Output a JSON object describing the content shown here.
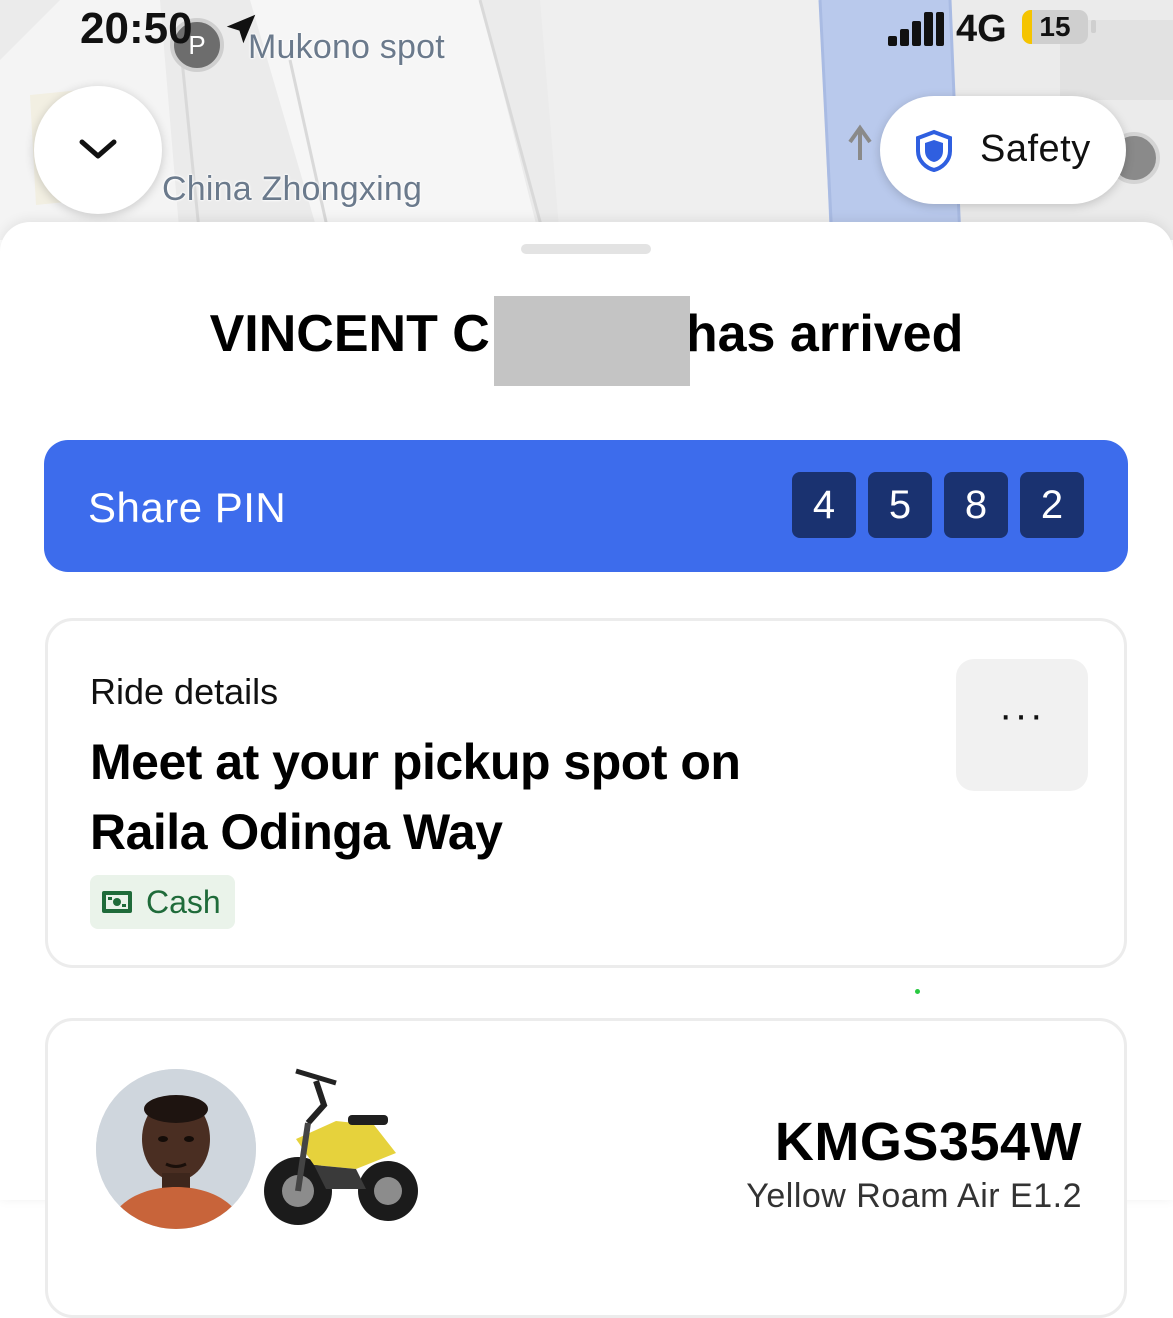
{
  "status_bar": {
    "time": "20:50",
    "network": "4G",
    "battery": "15",
    "battery_level": 0.15,
    "location_icon": "location-arrow-icon",
    "signal_icon": "signal-bars-icon"
  },
  "map": {
    "labels": {
      "place_1": "Mukono spot",
      "place_2": "China Zhongxing"
    },
    "poi_icon": "parking-pin-icon"
  },
  "map_controls": {
    "collapse_icon": "chevron-down-icon",
    "safety_label": "Safety",
    "safety_icon": "shield-icon"
  },
  "sheet": {
    "headline_prefix": "VINCENT C",
    "headline_suffix": "has arrived",
    "pin_banner": {
      "label": "Share PIN",
      "digits": [
        "4",
        "5",
        "8",
        "2"
      ]
    },
    "ride_details": {
      "kicker": "Ride details",
      "title": "Meet at your pickup spot on Raila Odinga Way",
      "payment_label": "Cash",
      "payment_icon": "cash-icon",
      "more_icon": "more-options-icon",
      "more_label": "···"
    },
    "driver": {
      "plate": "KMGS354W",
      "vehicle": "Yellow Roam Air E1.2"
    }
  },
  "colors": {
    "accent_blue": "#3d6cec",
    "pin_box": "#1a3270",
    "cash_green": "#1f6b3a",
    "battery_yellow": "#f5c400"
  }
}
